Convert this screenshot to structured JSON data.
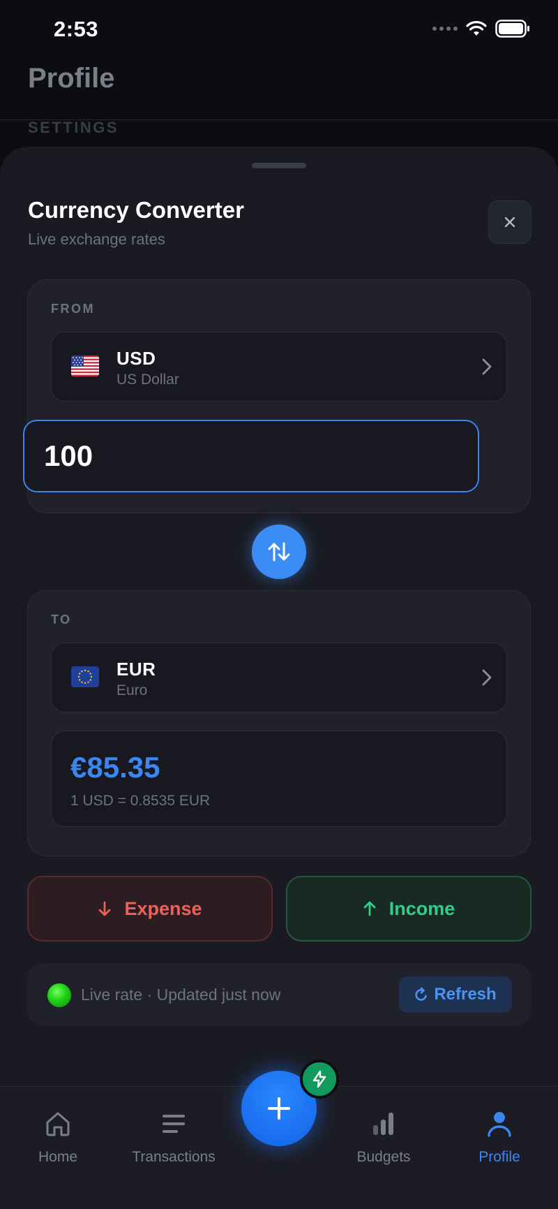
{
  "status_bar": {
    "time": "2:53"
  },
  "background_page": {
    "title": "Profile",
    "section_label": "SETTINGS"
  },
  "sheet": {
    "title": "Currency Converter",
    "subtitle": "Live exchange rates",
    "close_icon": "close-icon"
  },
  "from": {
    "label": "FROM",
    "currency_code": "USD",
    "currency_name": "US Dollar",
    "flag": "us-flag",
    "amount": "100"
  },
  "to": {
    "label": "TO",
    "currency_code": "EUR",
    "currency_name": "Euro",
    "flag": "eu-flag",
    "converted_amount": "€85.35",
    "rate_text": "1 USD = 0.8535 EUR"
  },
  "actions": {
    "expense_label": "Expense",
    "income_label": "Income"
  },
  "live": {
    "text": "Live rate · Updated just now",
    "refresh_label": "Refresh"
  },
  "tabs": [
    {
      "label": "Home",
      "icon": "home-icon",
      "active": false
    },
    {
      "label": "Transactions",
      "icon": "list-icon",
      "active": false
    },
    {
      "label": "Budgets",
      "icon": "bar-chart-icon",
      "active": false
    },
    {
      "label": "Profile",
      "icon": "person-icon",
      "active": true
    }
  ],
  "colors": {
    "accent": "#3d86f0",
    "expense": "#f0605b",
    "income": "#2fcf8a",
    "live": "#1fcf14"
  }
}
